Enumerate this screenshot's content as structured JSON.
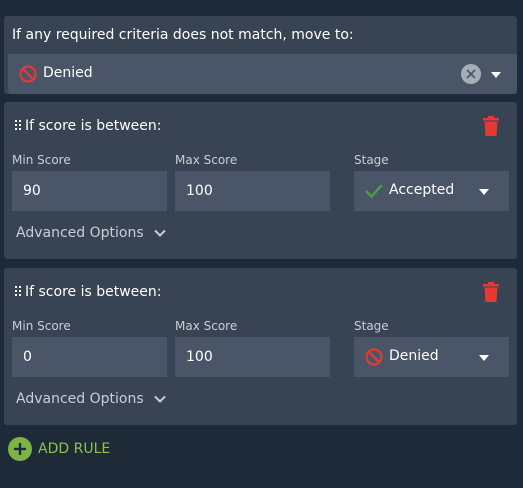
{
  "fallback": {
    "title": "If any required criteria does not match, move to:",
    "selected": "Denied",
    "selected_icon": "prohibited-icon"
  },
  "rules": [
    {
      "title": "If score is between:",
      "min_label": "Min Score",
      "max_label": "Max Score",
      "stage_label": "Stage",
      "min_value": "90",
      "max_value": "100",
      "stage": "Accepted",
      "stage_icon": "checkmark-icon",
      "advanced_label": "Advanced Options"
    },
    {
      "title": "If score is between:",
      "min_label": "Min Score",
      "max_label": "Max Score",
      "stage_label": "Stage",
      "min_value": "0",
      "max_value": "100",
      "stage": "Denied",
      "stage_icon": "prohibited-icon",
      "advanced_label": "Advanced Options"
    }
  ],
  "add_rule_label": "ADD RULE",
  "colors": {
    "background": "#1f2a38",
    "panel": "#384454",
    "field": "#4a5667",
    "delete_red": "#e53935",
    "denied_red": "#e53935",
    "accepted_green": "#43a047",
    "add_green": "#8bc34a"
  }
}
